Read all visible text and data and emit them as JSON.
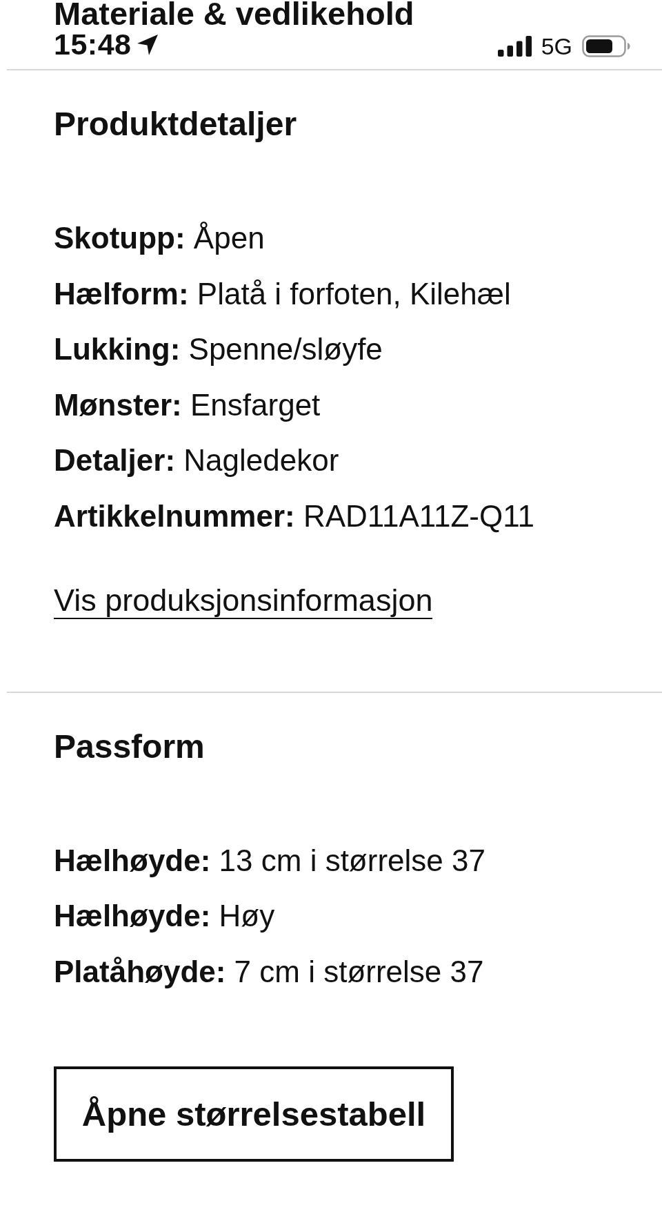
{
  "header": {
    "title": "Materiale & vedlikehold"
  },
  "status_bar": {
    "time": "15:48",
    "network": "5G"
  },
  "sections": [
    {
      "title": "Produktdetaljer",
      "details": [
        "**Skotupp:** Åpen",
        "**Hælform:** Platå i forfoten, Kilehæl",
        "**Lukking:** Spenne/sløyfe",
        "**Mønster:** Ensfarget",
        "**Detaljer:** Nagledekor",
        "**Artikkelnummer:** RAD11A11Z-Q11"
      ],
      "link": "Vis produksjonsinformasjon"
    },
    {
      "title": "Passform",
      "details": [
        "**Hælhøyde:** 13 cm i størrelse 37",
        "**Hælhøyde:** Høy",
        "**Platåhøyde:** 7 cm i størrelse 37"
      ],
      "button": "Åpne størrelsestabell"
    }
  ]
}
